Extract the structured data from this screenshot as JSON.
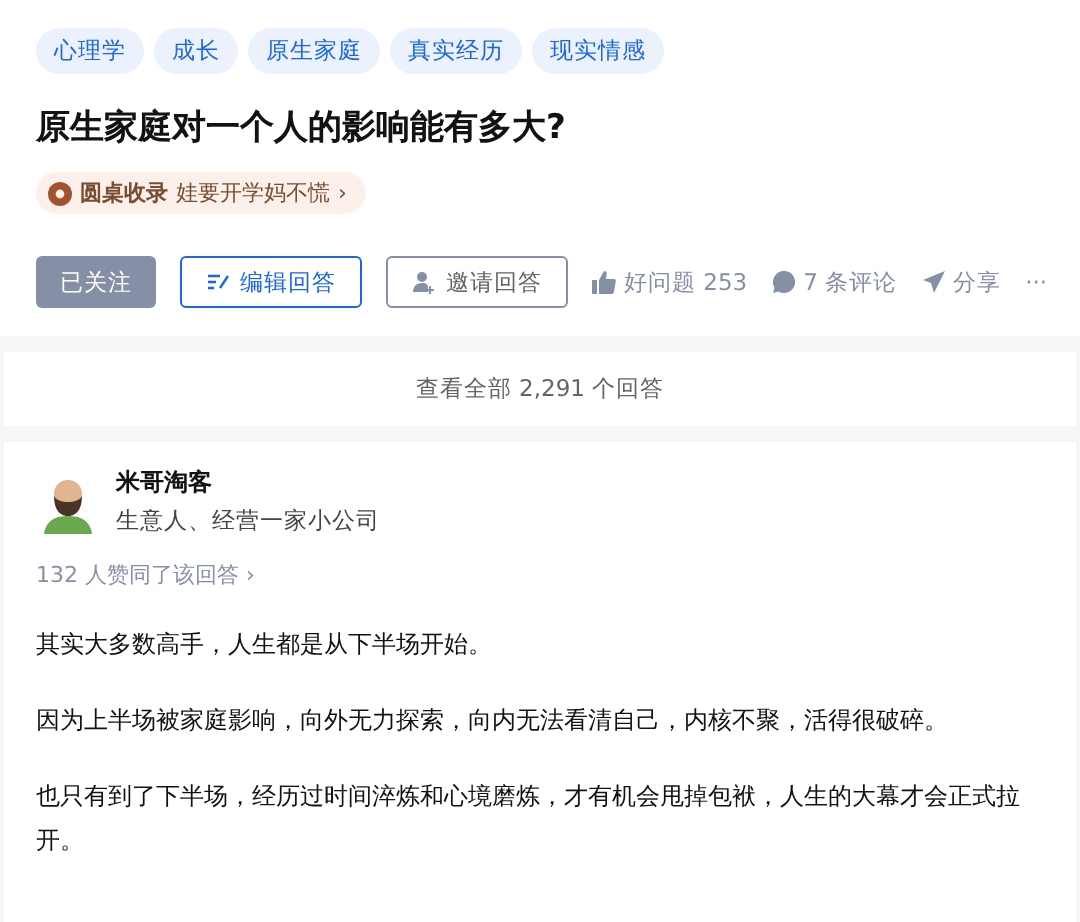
{
  "tags": [
    "心理学",
    "成长",
    "原生家庭",
    "真实经历",
    "现实情感"
  ],
  "question": {
    "title": "原生家庭对一个人的影响能有多大?",
    "collection": {
      "label": "圆桌收录",
      "name": "娃要开学妈不慌",
      "arrow": "›"
    }
  },
  "actions": {
    "follow": {
      "label": "已关注",
      "followed": true
    },
    "edit": "编辑回答",
    "invite": "邀请回答",
    "good": "好问题 253",
    "comments": "7 条评论",
    "share": "分享",
    "more": "···"
  },
  "view_all": "查看全部 2,291 个回答",
  "answer": {
    "author": "米哥淘客",
    "bio": "生意人、经营一家小公司",
    "votes": "132 人赞同了该回答 ›",
    "paragraphs": [
      "其实大多数高手，人生都是从下半场开始。",
      "因为上半场被家庭影响，向外无力探索，向内无法看清自己，内核不聚，活得很破碎。",
      "也只有到了下半场，经历过时间淬炼和心境磨炼，才有机会甩掉包袱，人生的大幕才会正式拉开。"
    ]
  }
}
